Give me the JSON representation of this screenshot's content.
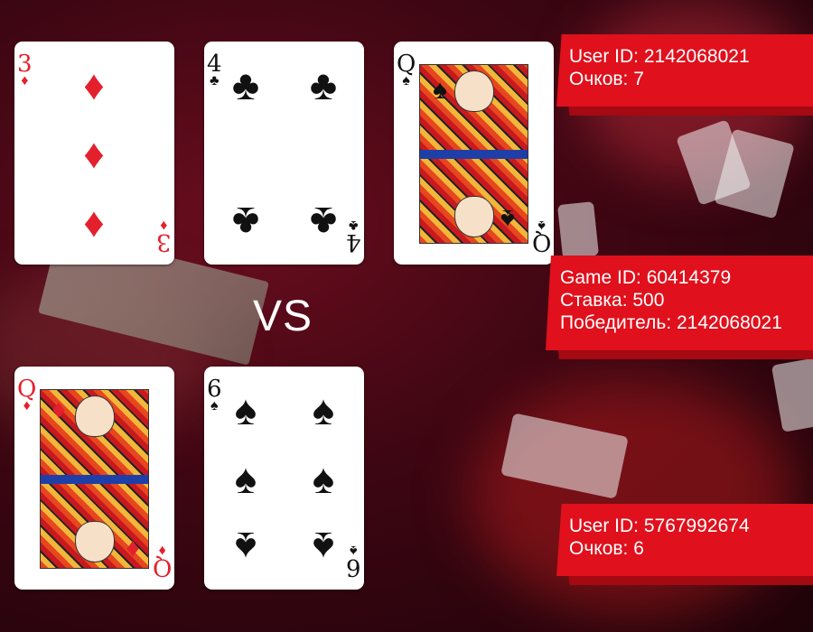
{
  "player1": {
    "user_id_label": "User ID: 2142068021",
    "score_label": "Очков: 7",
    "cards": [
      {
        "rank": "3",
        "suit": "diamonds",
        "suit_symbol": "♦",
        "color": "#e4202c"
      },
      {
        "rank": "4",
        "suit": "clubs",
        "suit_symbol": "♣",
        "color": "#111111"
      },
      {
        "rank": "Q",
        "suit": "spades",
        "suit_symbol": "♠",
        "color": "#111111"
      }
    ]
  },
  "versus_label": "VS",
  "game": {
    "game_id_label": "Game ID: 60414379",
    "bet_label": "Ставка: 500",
    "winner_label": "Победитель: 2142068021"
  },
  "player2": {
    "user_id_label": "User ID: 5767992674",
    "score_label": "Очков: 6",
    "cards": [
      {
        "rank": "Q",
        "suit": "diamonds",
        "suit_symbol": "♦",
        "color": "#e4202c"
      },
      {
        "rank": "6",
        "suit": "spades",
        "suit_symbol": "♠",
        "color": "#111111"
      }
    ]
  },
  "colors": {
    "banner": "#e0101c",
    "background": "#3d0612"
  }
}
